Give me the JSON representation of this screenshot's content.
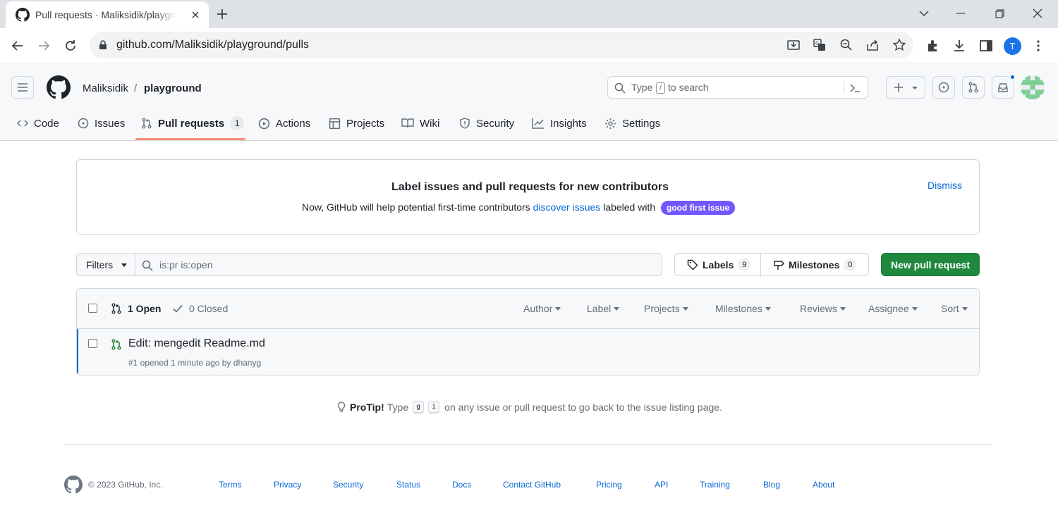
{
  "browser": {
    "tab_title": "Pull requests · Maliksidik/playground",
    "url": "github.com/Maliksidik/playground/pulls",
    "profile_initial": "T"
  },
  "header": {
    "owner": "Maliksidik",
    "separator": "/",
    "repo": "playground",
    "search_prefix": "Type",
    "search_key": "/",
    "search_suffix": "to search"
  },
  "repo_nav": [
    {
      "label": "Code",
      "icon": "code-icon"
    },
    {
      "label": "Issues",
      "icon": "issue-icon"
    },
    {
      "label": "Pull requests",
      "icon": "pull-request-icon",
      "count": "1",
      "selected": true
    },
    {
      "label": "Actions",
      "icon": "play-icon"
    },
    {
      "label": "Projects",
      "icon": "table-icon"
    },
    {
      "label": "Wiki",
      "icon": "book-icon"
    },
    {
      "label": "Security",
      "icon": "shield-icon"
    },
    {
      "label": "Insights",
      "icon": "graph-icon"
    },
    {
      "label": "Settings",
      "icon": "gear-icon"
    }
  ],
  "banner": {
    "title": "Label issues and pull requests for new contributors",
    "text_before": "Now, GitHub will help potential first-time contributors ",
    "link": "discover issues",
    "text_after": " labeled with ",
    "label": "good first issue",
    "dismiss": "Dismiss",
    "label_color": "#7057ff"
  },
  "filters": {
    "button": "Filters",
    "query": "is:pr is:open",
    "labels": "Labels",
    "labels_count": "9",
    "milestones": "Milestones",
    "milestones_count": "0",
    "new_pr": "New pull request"
  },
  "list": {
    "open": "1 Open",
    "closed": "0 Closed",
    "header_filters": [
      "Author",
      "Label",
      "Projects",
      "Milestones",
      "Reviews",
      "Assignee",
      "Sort"
    ],
    "items": [
      {
        "title": "Edit: mengedit Readme.md",
        "meta": "#1 opened 1 minute ago by dhanyg"
      }
    ]
  },
  "protip": {
    "bold": "ProTip!",
    "before": "Type",
    "key1": "g",
    "key2": "i",
    "after": "on any issue or pull request to go back to the issue listing page."
  },
  "footer": {
    "copyright": "© 2023 GitHub, Inc.",
    "links": [
      "Terms",
      "Privacy",
      "Security",
      "Status",
      "Docs",
      "Contact GitHub",
      "Pricing",
      "API",
      "Training",
      "Blog",
      "About"
    ]
  },
  "colors": {
    "accent": "#0969da",
    "primary_button": "#1f883d",
    "nav_underline": "#fd8c73",
    "open_pr": "#1a7f37"
  }
}
